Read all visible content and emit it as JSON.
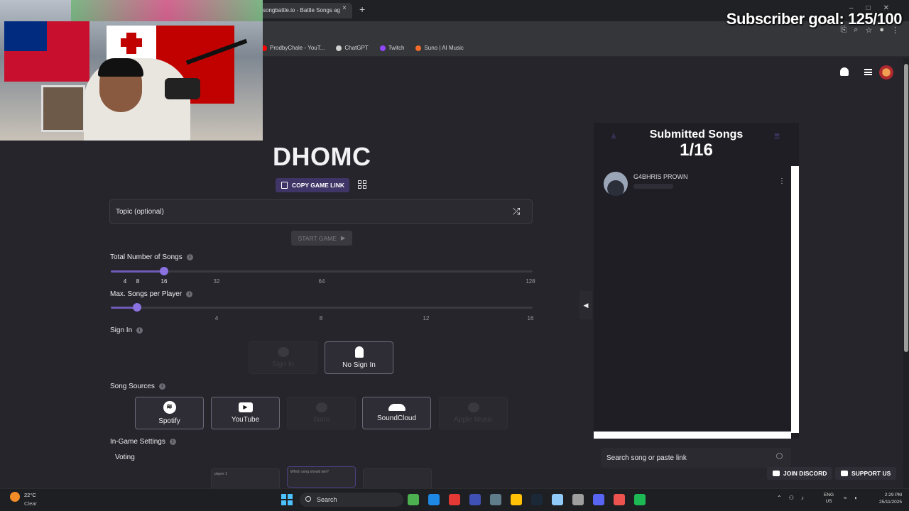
{
  "browser": {
    "tab_title": "songbattle.io - Battle Songs ag",
    "tab_close": "×",
    "new_tab": "+",
    "bookmarks": [
      {
        "label": "ProdbyChale - YouT...",
        "icon": "youtube-icon",
        "color": "#ff0000"
      },
      {
        "label": "ChatGPT",
        "icon": "chatgpt-icon",
        "color": "#d0d0d0"
      },
      {
        "label": "Twitch",
        "icon": "twitch-icon",
        "color": "#9146ff"
      },
      {
        "label": "Suno | AI Music",
        "icon": "suno-icon",
        "color": "#f26b2a"
      }
    ]
  },
  "overlay": {
    "subscriber_goal": "Subscriber goal: 125/100"
  },
  "room": {
    "title": "DHOMC",
    "copy_link_label": "COPY GAME LINK",
    "topic_placeholder": "Topic (optional)",
    "start_label": "START GAME",
    "shuffle_icon": "⤮"
  },
  "settings": {
    "total_songs_label": "Total Number of Songs",
    "total_songs_ticks": [
      "4",
      "8",
      "16",
      "32",
      "64",
      "128"
    ],
    "total_songs_value": 16,
    "max_per_player_label": "Max. Songs per Player",
    "max_per_player_ticks": [
      "4",
      "8",
      "12",
      "16"
    ],
    "max_per_player_value": 1,
    "sign_in_label": "Sign In",
    "sign_in_options": [
      {
        "label": "Sign In",
        "state": "disabled"
      },
      {
        "label": "No Sign In",
        "state": "selected"
      }
    ],
    "song_sources_label": "Song Sources",
    "song_sources": [
      {
        "label": "Spotify",
        "state": "selected",
        "icon": "spotify-icon"
      },
      {
        "label": "YouTube",
        "state": "selected",
        "icon": "youtube-icon"
      },
      {
        "label": "Suno",
        "state": "disabled",
        "icon": "suno-icon"
      },
      {
        "label": "SoundCloud",
        "state": "selected",
        "icon": "soundcloud-icon"
      },
      {
        "label": "Apple Music",
        "state": "disabled",
        "icon": "apple-music-icon"
      }
    ],
    "in_game_label": "In-Game Settings",
    "voting_label": "Voting",
    "voting_options": [
      {
        "label": "player 1"
      },
      {
        "label": "Which song should win?"
      },
      {
        "label": ""
      }
    ]
  },
  "submitted": {
    "title": "Submitted Songs",
    "count": "1/16",
    "songs": [
      {
        "title": "G4BHRIS PROWN"
      }
    ],
    "search_placeholder": "Search song or paste link"
  },
  "footer": {
    "discord_label": "JOIN DISCORD",
    "support_label": "SUPPORT US"
  },
  "taskbar": {
    "weather_temp": "22°C",
    "weather_cond": "Clear",
    "search_label": "Search",
    "lang_top": "ENG",
    "lang_bottom": "US",
    "time": "2:29 PM",
    "date": "25/11/2025",
    "app_colors": [
      "#4caf50",
      "#1e88e5",
      "#e53935",
      "#3f51b5",
      "#607d8b",
      "#ffc107",
      "#1b2838",
      "#90caf9",
      "#9e9e9e",
      "#5865f2",
      "#ef5350",
      "#1db954"
    ]
  }
}
